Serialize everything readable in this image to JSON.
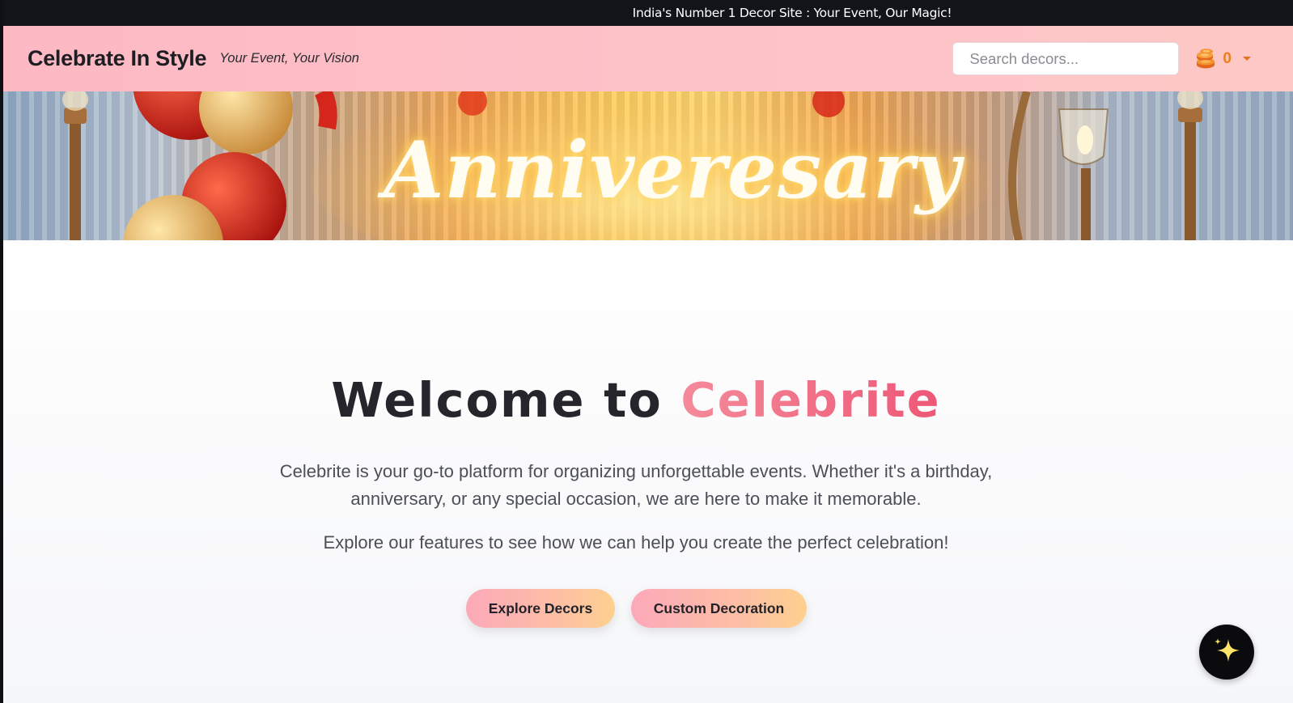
{
  "announcement": {
    "text": "India's Number 1 Decor Site : Your Event, Our Magic!"
  },
  "navbar": {
    "brand": "Celebrate In Style",
    "tagline": "Your Event, Your Vision",
    "search": {
      "placeholder": "Search decors...",
      "value": ""
    },
    "coins": {
      "count": "0",
      "icon": "coins-icon"
    }
  },
  "banner": {
    "text": "Anniveresary",
    "alt": "Anniversary decoration banner"
  },
  "hero": {
    "title_prefix": "Welcome to ",
    "title_accent": "Celebrite",
    "description": "Celebrite is your go-to platform for organizing unforgettable events. Whether it's a birthday, anniversary, or any special occasion, we are here to make it memorable.",
    "subdescription": "Explore our features to see how we can help you create the perfect celebration!",
    "buttons": {
      "explore": "Explore Decors",
      "custom": "Custom Decoration"
    }
  },
  "assistant": {
    "icon": "sparkle-icon"
  },
  "colors": {
    "announcement_bg": "#12141a",
    "navbar_bg": "#fdc2c8",
    "accent_pink": "#f0627e",
    "coin_orange": "#ef7d21",
    "button_gradient_start": "#fca9b9",
    "button_gradient_end": "#fdd08f"
  }
}
